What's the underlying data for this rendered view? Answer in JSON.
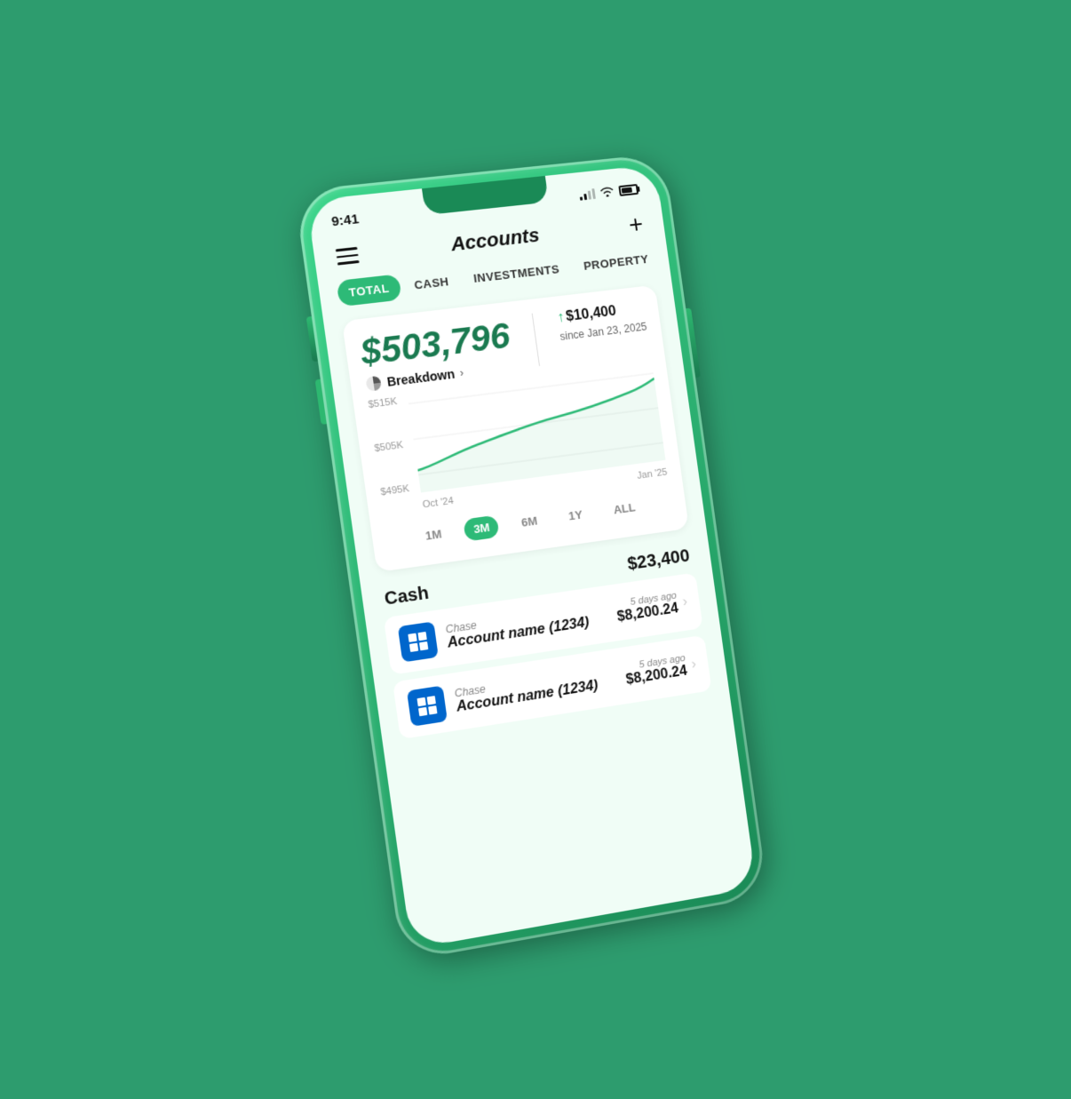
{
  "status_bar": {
    "time": "9:41"
  },
  "header": {
    "title": "Accounts",
    "add_label": "+"
  },
  "tabs": [
    {
      "id": "total",
      "label": "TOTAL",
      "active": true
    },
    {
      "id": "cash",
      "label": "CASH",
      "active": false
    },
    {
      "id": "investments",
      "label": "INVESTMENTS",
      "active": false
    },
    {
      "id": "property",
      "label": "PROPERTY",
      "active": false
    }
  ],
  "summary_card": {
    "total_amount": "$503,796",
    "breakdown_label": "Breakdown",
    "change_amount": "$10,400",
    "change_date": "since Jan 23,\n2025",
    "chart": {
      "y_labels": [
        "$515K",
        "$505K",
        "$495K"
      ],
      "x_labels": [
        "Oct '24",
        "Jan '25"
      ]
    },
    "time_ranges": [
      {
        "label": "1M",
        "active": false
      },
      {
        "label": "3M",
        "active": true
      },
      {
        "label": "6M",
        "active": false
      },
      {
        "label": "1Y",
        "active": false
      },
      {
        "label": "ALL",
        "active": false
      }
    ]
  },
  "cash_section": {
    "title": "Cash",
    "total": "$23,400",
    "accounts": [
      {
        "bank": "Chase",
        "name": "Account name (1234)",
        "last_updated": "5 days ago",
        "balance": "$8,200.24"
      },
      {
        "bank": "Chase",
        "name": "Account name (1234)",
        "last_updated": "5 days ago",
        "balance": "$8,200.24"
      }
    ]
  },
  "colors": {
    "green_accent": "#2dba77",
    "dark_green": "#1a7a50",
    "brand_bg": "#2d9c6e"
  }
}
